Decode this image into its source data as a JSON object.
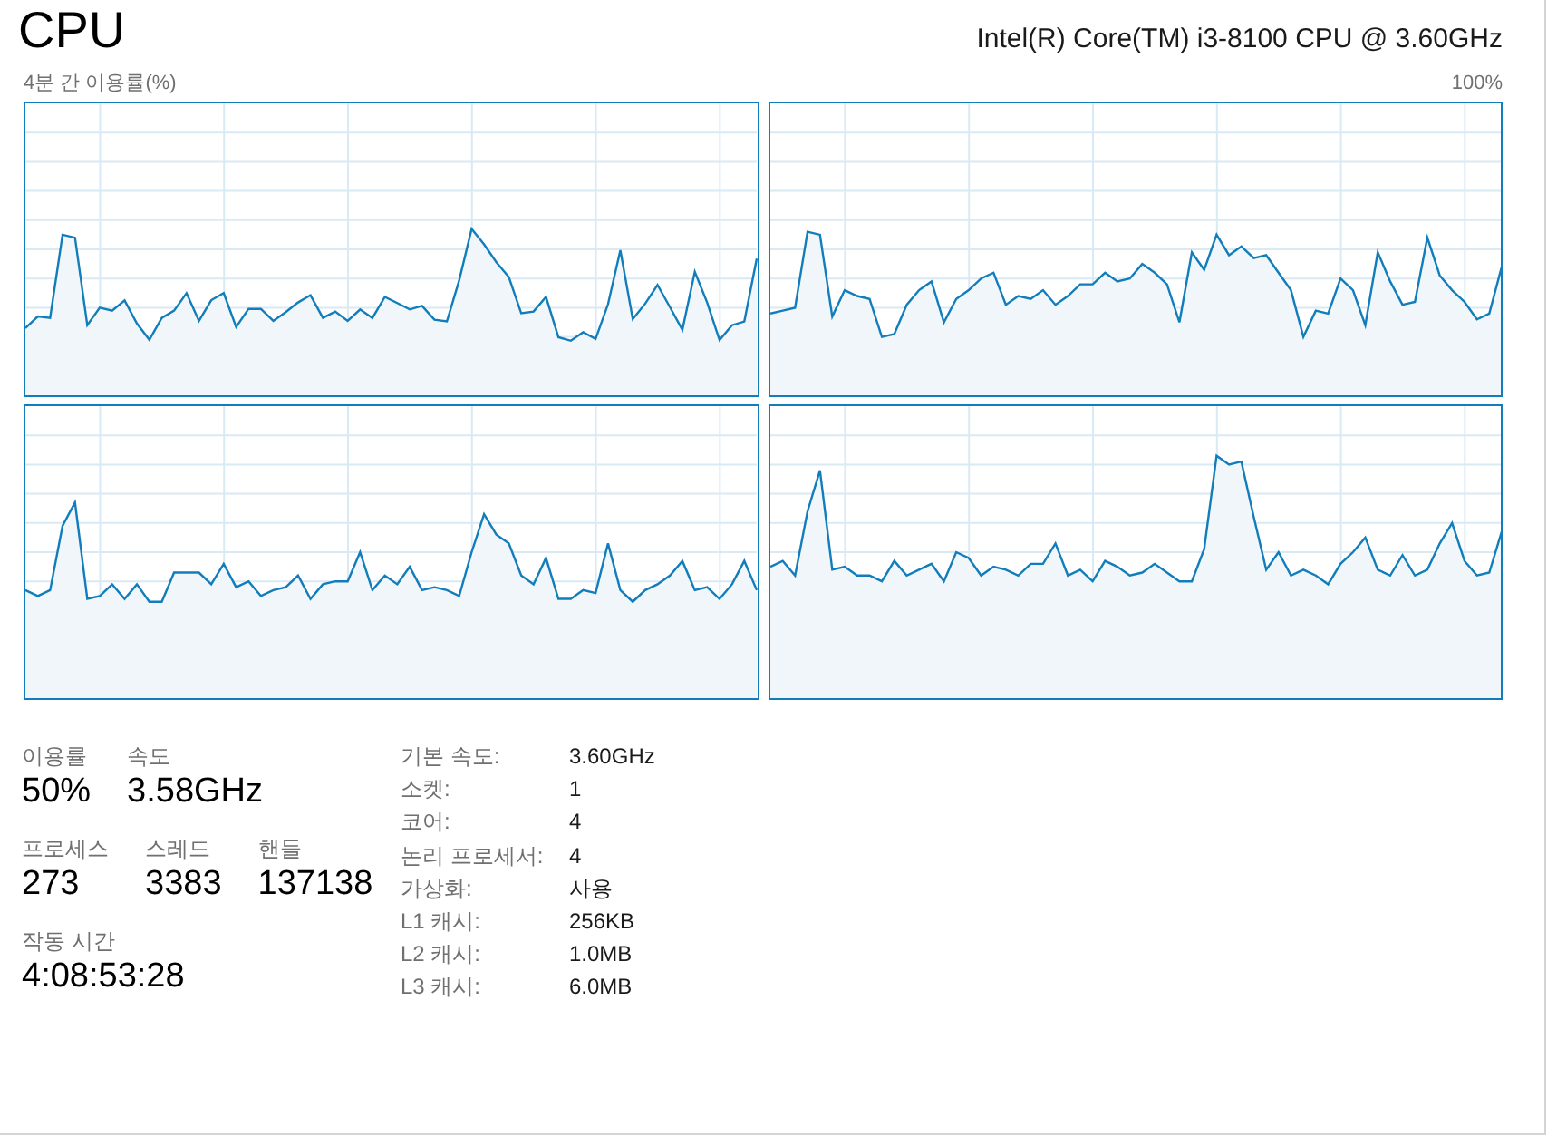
{
  "header": {
    "title": "CPU",
    "processor_name": "Intel(R) Core(TM) i3-8100 CPU @ 3.60GHz"
  },
  "graph_caption": {
    "label": "4분 간 이용률(%)",
    "max": "100%"
  },
  "stats": [
    [
      {
        "label": "이용률",
        "value": "50%"
      },
      {
        "label": "속도",
        "value": "3.58GHz"
      }
    ],
    [
      {
        "label": "프로세스",
        "value": "273"
      },
      {
        "label": "스레드",
        "value": "3383"
      },
      {
        "label": "핸들",
        "value": "137138"
      }
    ],
    [
      {
        "label": "작동 시간",
        "value": "4:08:53:28"
      }
    ]
  ],
  "details": [
    {
      "label": "기본 속도:",
      "value": "3.60GHz"
    },
    {
      "label": "소켓:",
      "value": "1"
    },
    {
      "label": "코어:",
      "value": "4"
    },
    {
      "label": "논리 프로세서:",
      "value": "4"
    },
    {
      "label": "가상화:",
      "value": "사용"
    },
    {
      "label": "L1 캐시:",
      "value": "256KB"
    },
    {
      "label": "L2 캐시:",
      "value": "1.0MB"
    },
    {
      "label": "L3 캐시:",
      "value": "6.0MB"
    }
  ]
}
